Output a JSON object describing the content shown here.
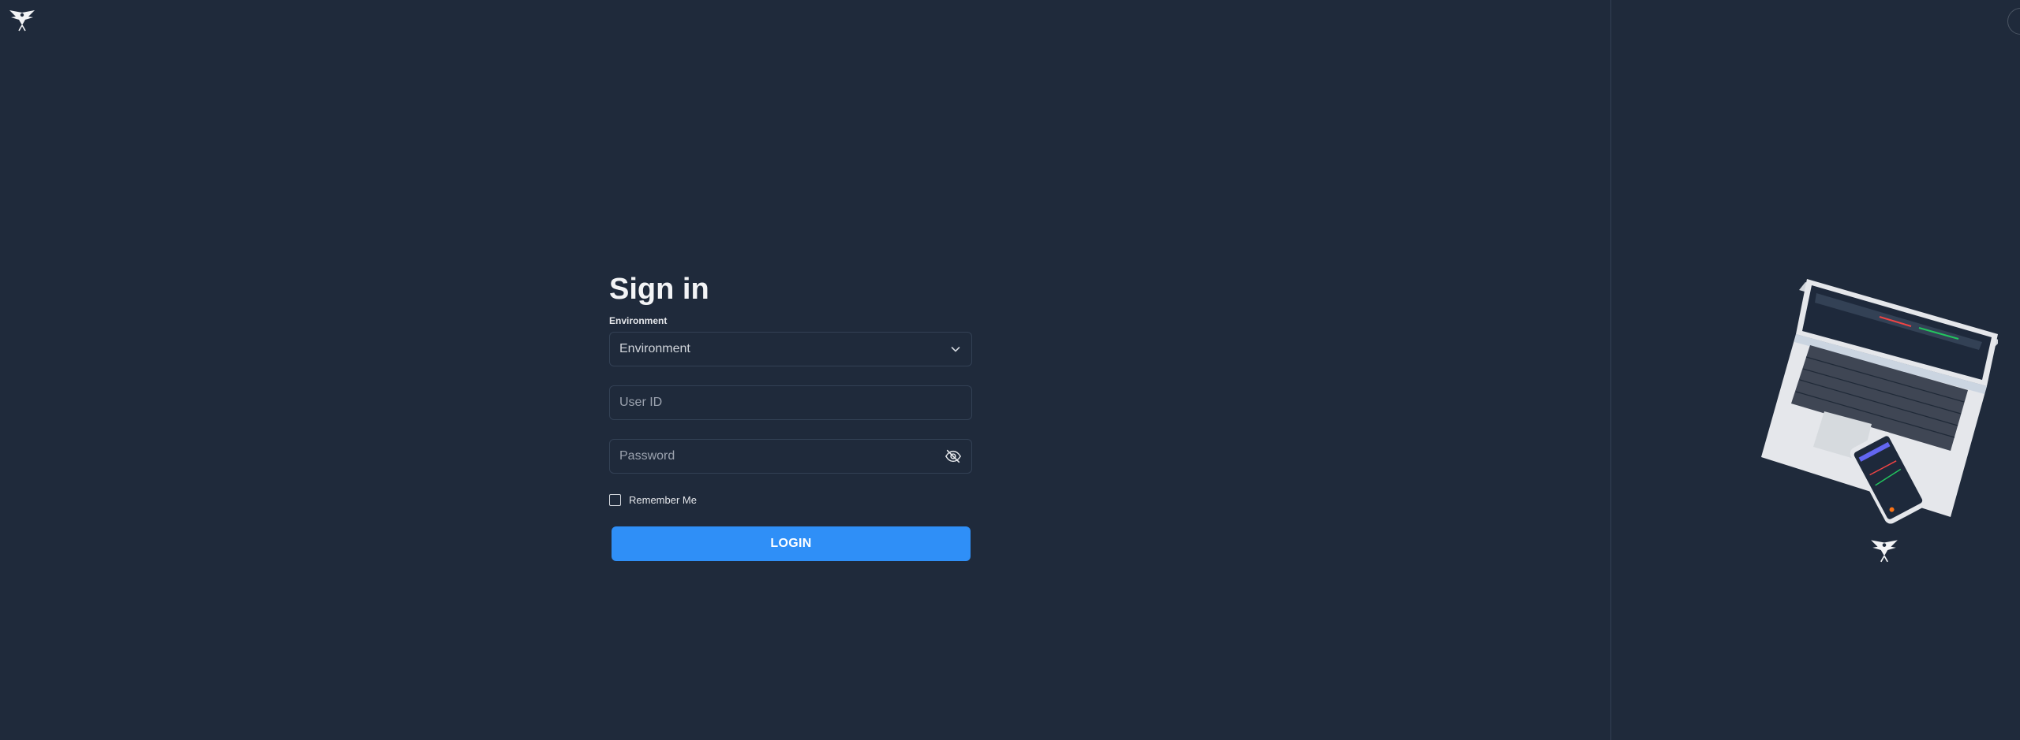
{
  "form": {
    "title": "Sign in",
    "environment_label": "Environment",
    "environment_selected": "Environment",
    "user_id_placeholder": "User ID",
    "user_id_value": "",
    "password_placeholder": "Password",
    "password_value": "",
    "remember_label": "Remember Me",
    "remember_checked": false,
    "login_label": "LOGIN"
  },
  "icons": {
    "brand": "winged-logo-icon",
    "select": "chevron-down-icon",
    "password_toggle": "eye-off-icon"
  },
  "colors": {
    "background": "#1f2a3b",
    "field_border": "#334155",
    "accent": "#2f8ff7",
    "text": "#e5e7eb"
  }
}
